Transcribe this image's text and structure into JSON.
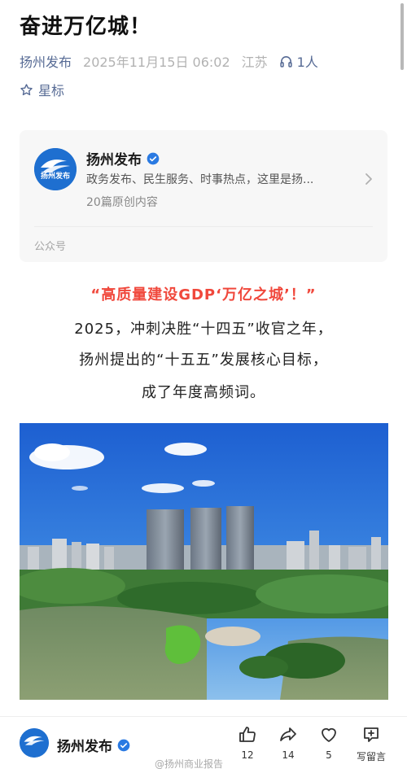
{
  "article": {
    "title": "奋进万亿城！",
    "author": "扬州发布",
    "time": "2025年11月15日 06:02",
    "location": "江苏",
    "listen_count": "1人",
    "star_label": "星标"
  },
  "account_card": {
    "logo_text": "扬州发布",
    "name": "扬州发布",
    "description": "政务发布、民生服务、时事热点，这里是扬...",
    "original_count": "20篇原创内容",
    "label": "公众号"
  },
  "body": {
    "headline": "“高质量建设GDP‘万亿之城’！”",
    "lines": [
      "2025，冲刺决胜“十四五”收官之年，",
      "扬州提出的“十五五”发展核心目标，",
      "成了年度高频词。"
    ]
  },
  "bottom_bar": {
    "name": "扬州发布",
    "like_count": "12",
    "share_count": "14",
    "fav_count": "5",
    "comment_label": "写留言"
  },
  "watermark": "@扬州商业报告",
  "colors": {
    "link": "#576b95",
    "headline": "#f0483c",
    "verified": "#2a7ae2",
    "logo": "#1e6fd0"
  },
  "icons": [
    "headphone-icon",
    "star-icon",
    "verified-icon",
    "chevron-right-icon",
    "thumbs-up-icon",
    "share-icon",
    "heart-icon",
    "comment-icon"
  ]
}
